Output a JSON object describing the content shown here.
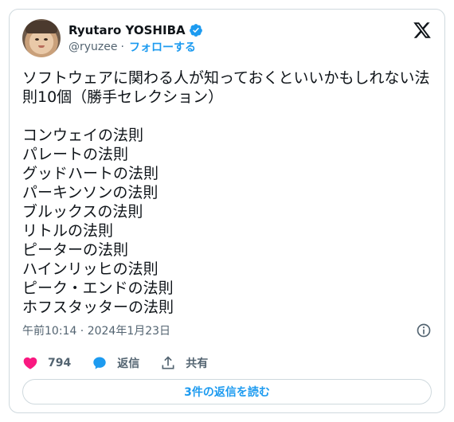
{
  "author": {
    "display_name": "Ryutaro YOSHIBA",
    "handle": "@ryuzee",
    "separator": "·",
    "follow_label": "フォローする",
    "verified": true
  },
  "tweet": {
    "text": "ソフトウェアに関わる人が知っておくといいかもしれない法則10個（勝手セレクション）\n\nコンウェイの法則\nパレートの法則\nグッドハートの法則\nパーキンソンの法則\nブルックスの法則\nリトルの法則\nピーターの法則\nハインリッヒの法則\nピーク・エンドの法則\nホフスタッターの法則",
    "timestamp": "午前10:14 · 2024年1月23日"
  },
  "actions": {
    "like_count": "794",
    "reply_label": "返信",
    "share_label": "共有"
  },
  "replies_button_label": "3件の返信を読む",
  "colors": {
    "accent": "#1d9bf0",
    "like": "#f91880",
    "text": "#0f1419",
    "secondary": "#536471",
    "border": "#cfd9de"
  },
  "icons": [
    "verified-badge-icon",
    "x-logo-icon",
    "info-icon",
    "heart-icon",
    "reply-bubble-icon",
    "share-icon"
  ]
}
